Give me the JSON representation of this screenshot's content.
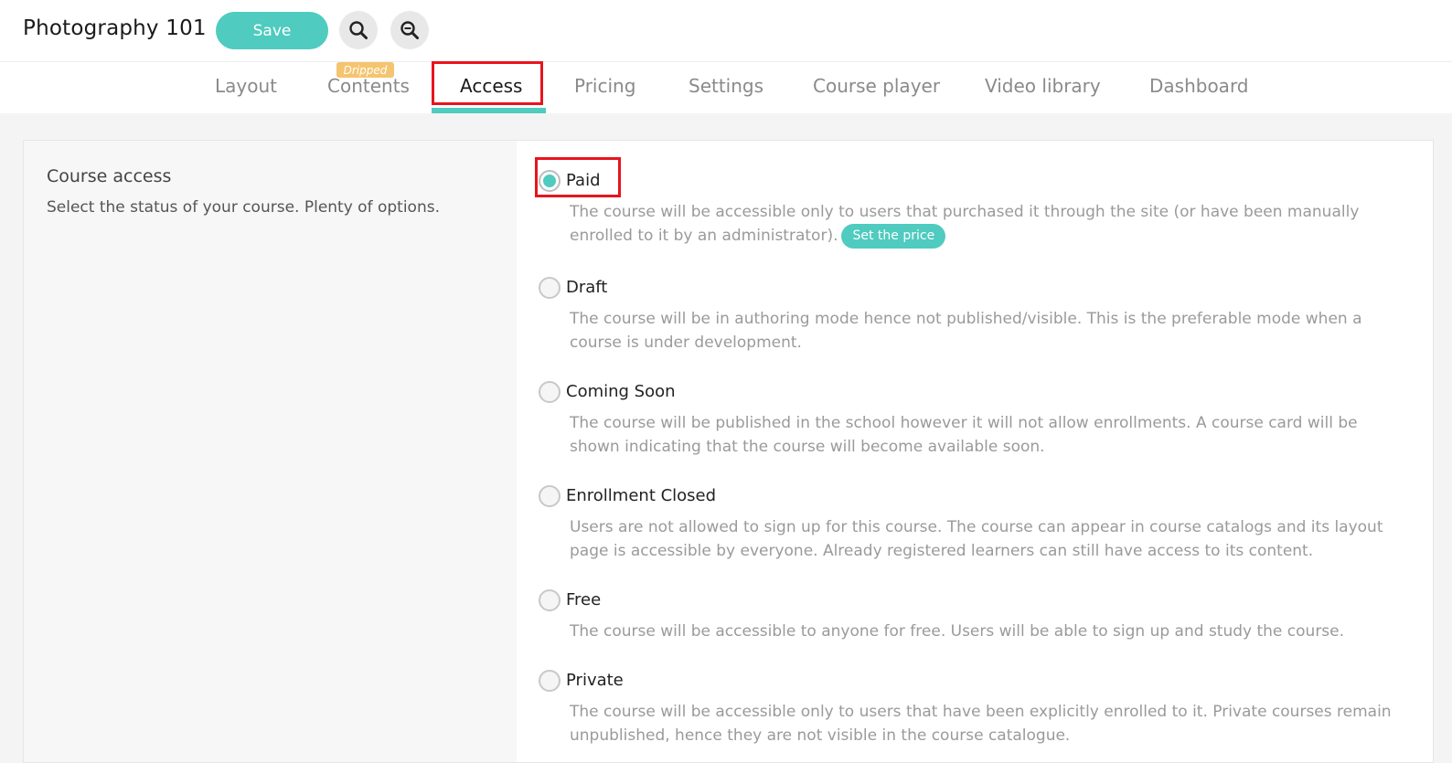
{
  "header": {
    "course_title": "Photography 101",
    "save_label": "Save",
    "search_icon": "search-icon",
    "zoom_icon": "zoom-out-icon"
  },
  "tabs": [
    {
      "label": "Layout"
    },
    {
      "label": "Contents",
      "badge": "Dripped"
    },
    {
      "label": "Access",
      "active": true
    },
    {
      "label": "Pricing"
    },
    {
      "label": "Settings"
    },
    {
      "label": "Course player"
    },
    {
      "label": "Video library"
    },
    {
      "label": "Dashboard"
    }
  ],
  "section": {
    "title": "Course access",
    "description": "Select the status of your course. Plenty of options."
  },
  "options": [
    {
      "label": "Paid",
      "checked": true,
      "description": "The course will be accessible only to users that purchased it through the site (or have been manually enrolled to it by an administrator).",
      "action_label": "Set the price"
    },
    {
      "label": "Draft",
      "checked": false,
      "description": "The course will be in authoring mode hence not published/visible. This is the preferable mode when a course is under development."
    },
    {
      "label": "Coming Soon",
      "checked": false,
      "description": "The course will be published in the school however it will not allow enrollments. A course card will be shown indicating that the course will become available soon."
    },
    {
      "label": "Enrollment Closed",
      "checked": false,
      "description": "Users are not allowed to sign up for this course. The course can appear in course catalogs and its layout page is accessible by everyone. Already registered learners can still have access to its content."
    },
    {
      "label": "Free",
      "checked": false,
      "description": "The course will be accessible to anyone for free. Users will be able to sign up and study the course."
    },
    {
      "label": "Private",
      "checked": false,
      "description": "The course will be accessible only to users that have been explicitly enrolled to it. Private courses remain unpublished, hence they are not visible in the course catalogue."
    }
  ],
  "colors": {
    "accent": "#4fcbbf",
    "badge": "#f5c46e",
    "highlight": "#e8141c"
  }
}
